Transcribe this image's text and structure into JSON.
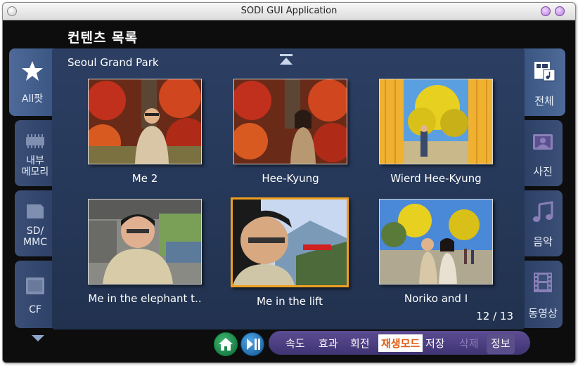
{
  "window": {
    "title": "SODI GUI Application"
  },
  "header": {
    "title": "컨텐츠 목록"
  },
  "folder": {
    "name": "Seoul Grand Park"
  },
  "left_tabs": [
    {
      "label": "All팟",
      "icon": "star-icon",
      "active": true
    },
    {
      "label_line1": "내부",
      "label_line2": "메모리",
      "icon": "memory-chip-icon",
      "active": false
    },
    {
      "label_line1": "SD/",
      "label_line2": "MMC",
      "icon": "sd-card-icon",
      "active": false
    },
    {
      "label": "CF",
      "icon": "cf-card-icon",
      "active": false
    }
  ],
  "right_tabs": [
    {
      "label": "전체",
      "icon": "all-media-icon",
      "active": true
    },
    {
      "label": "사진",
      "icon": "photo-icon",
      "active": false
    },
    {
      "label": "음악",
      "icon": "music-note-icon",
      "active": false
    },
    {
      "label": "동영상",
      "icon": "film-strip-icon",
      "active": false
    }
  ],
  "thumbnails": [
    {
      "caption": "Me 2",
      "selected": false
    },
    {
      "caption": "Hee-Kyung",
      "selected": false
    },
    {
      "caption": "Wierd Hee-Kyung",
      "selected": false
    },
    {
      "caption": "Me in the elephant t..",
      "selected": false
    },
    {
      "caption": "Me in the lift",
      "selected": true
    },
    {
      "caption": "Noriko and I",
      "selected": false
    }
  ],
  "pager": {
    "text": "12 / 13"
  },
  "toolbar": {
    "items": [
      {
        "label": "속도"
      },
      {
        "label": "효과"
      },
      {
        "label": "회전"
      },
      {
        "label": "재생모드",
        "active": true
      },
      {
        "label": "저장"
      },
      {
        "label": "삭제",
        "disabled": true
      },
      {
        "label": "정보"
      }
    ]
  },
  "colors": {
    "panel": "#2c3f63",
    "selection": "#f0a020",
    "toolbar": "#4c3f82",
    "home_button": "#1f8a4c",
    "play_button": "#2a7cc0"
  }
}
